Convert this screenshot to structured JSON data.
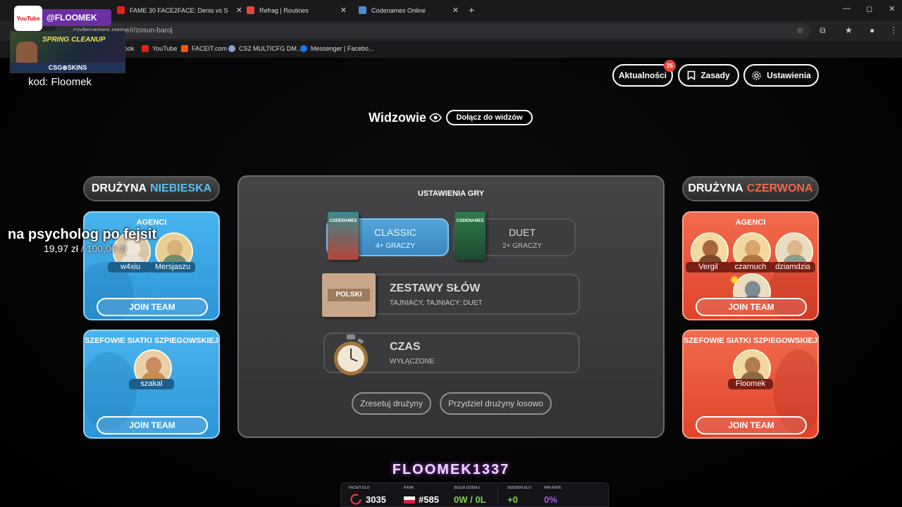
{
  "browser": {
    "tabs": [
      {
        "title": "",
        "color": "#e62117"
      },
      {
        "title": "FAME 30 FACE2FACE: Denis vs S",
        "color": "#e62117"
      },
      {
        "title": "Refrag | Routines",
        "color": "#e8453c"
      },
      {
        "title": "Codenames Online",
        "color": "#4d8ad6"
      }
    ],
    "new_tab": "+",
    "url": "codenames.game/r/zosun-baroj",
    "bookmarks": [
      {
        "label": "ook",
        "color": "#1877f2"
      },
      {
        "label": "YouTube",
        "color": "#e62117"
      },
      {
        "label": "FACEIT.com",
        "color": "#ff5500"
      },
      {
        "label": "CS2 MULTICFG DM...",
        "color": "#8aa0c8"
      },
      {
        "label": "Messenger | Facebo...",
        "color": "#1877f2"
      }
    ]
  },
  "overlay": {
    "yt_badge": "YouTube",
    "handle": "@FLOOMEK",
    "promo_title": "SPRING CLEANUP",
    "promo_brand": "CSG⊕SKINS",
    "code": "kod: Floomek",
    "donation_message": "na psycholog po fejsit",
    "donation_amount": "19,97 zł",
    "donation_goal": "/ 100,00 zł"
  },
  "header": {
    "news_label": "Aktualności",
    "news_count": "25",
    "rules_label": "Zasady",
    "settings_label": "Ustawienia",
    "spectators_label": "Widzowie",
    "join_spectators": "Dołącz do widzów"
  },
  "blue_team": {
    "header_prefix": "DRUŻYNA",
    "header_color_word": "NIEBIESKA",
    "agents_title": "AGENCI",
    "agents": [
      "w4xiu",
      "Mersjaszu"
    ],
    "spymasters_title": "SZEFOWIE SIATKI SZPIEGOWSKIEJ",
    "spymasters": [
      "szakal"
    ],
    "join_label": "JOIN TEAM",
    "color": "#48b4ee"
  },
  "red_team": {
    "header_prefix": "DRUŻYNA",
    "header_color_word": "CZERWONA",
    "agents_title": "AGENCI",
    "agents": [
      "Vergil",
      "czarnuch",
      "dziamdzia"
    ],
    "spymasters_title": "SZEFOWIE SIATKI SZPIEGOWSKIEJ",
    "spymasters": [
      "Floomek"
    ],
    "join_label": "JOIN TEAM",
    "color": "#f26a4c"
  },
  "game_settings": {
    "title": "USTAWIENIA GRY",
    "modes": [
      {
        "name": "CLASSIC",
        "players": "4+ GRACZY",
        "box_label": "CODENAMES",
        "selected": true
      },
      {
        "name": "DUET",
        "players": "2+ GRACZY",
        "box_label": "CODENAMES",
        "selected": false
      }
    ],
    "word_sets_title": "ZESTAWY SŁÓW",
    "word_sets_value": "TAJNIACY, TAJNIACY: DUET",
    "word_sets_language": "POLSKI",
    "timer_title": "CZAS",
    "timer_value": "WYŁĄCZONE",
    "reset_teams": "Zresetuj drużyny",
    "randomize_teams": "Przydziel drużyny losowo"
  },
  "streamer": {
    "name": "FLOOMEK1337",
    "stats": [
      {
        "label": "FACEIT ELO",
        "value": "3035",
        "color": "#ffffff"
      },
      {
        "label": "RANK",
        "value": "#585",
        "color": "#ffffff"
      },
      {
        "label": "SESJA DZISIAJ",
        "value": "0W / 0L",
        "color": "#7bd64a"
      },
      {
        "label": "SESSION ELO",
        "value": "+0",
        "color": "#7bd64a"
      },
      {
        "label": "WIN RATE",
        "value": "0%",
        "color": "#a45ee0"
      }
    ]
  }
}
